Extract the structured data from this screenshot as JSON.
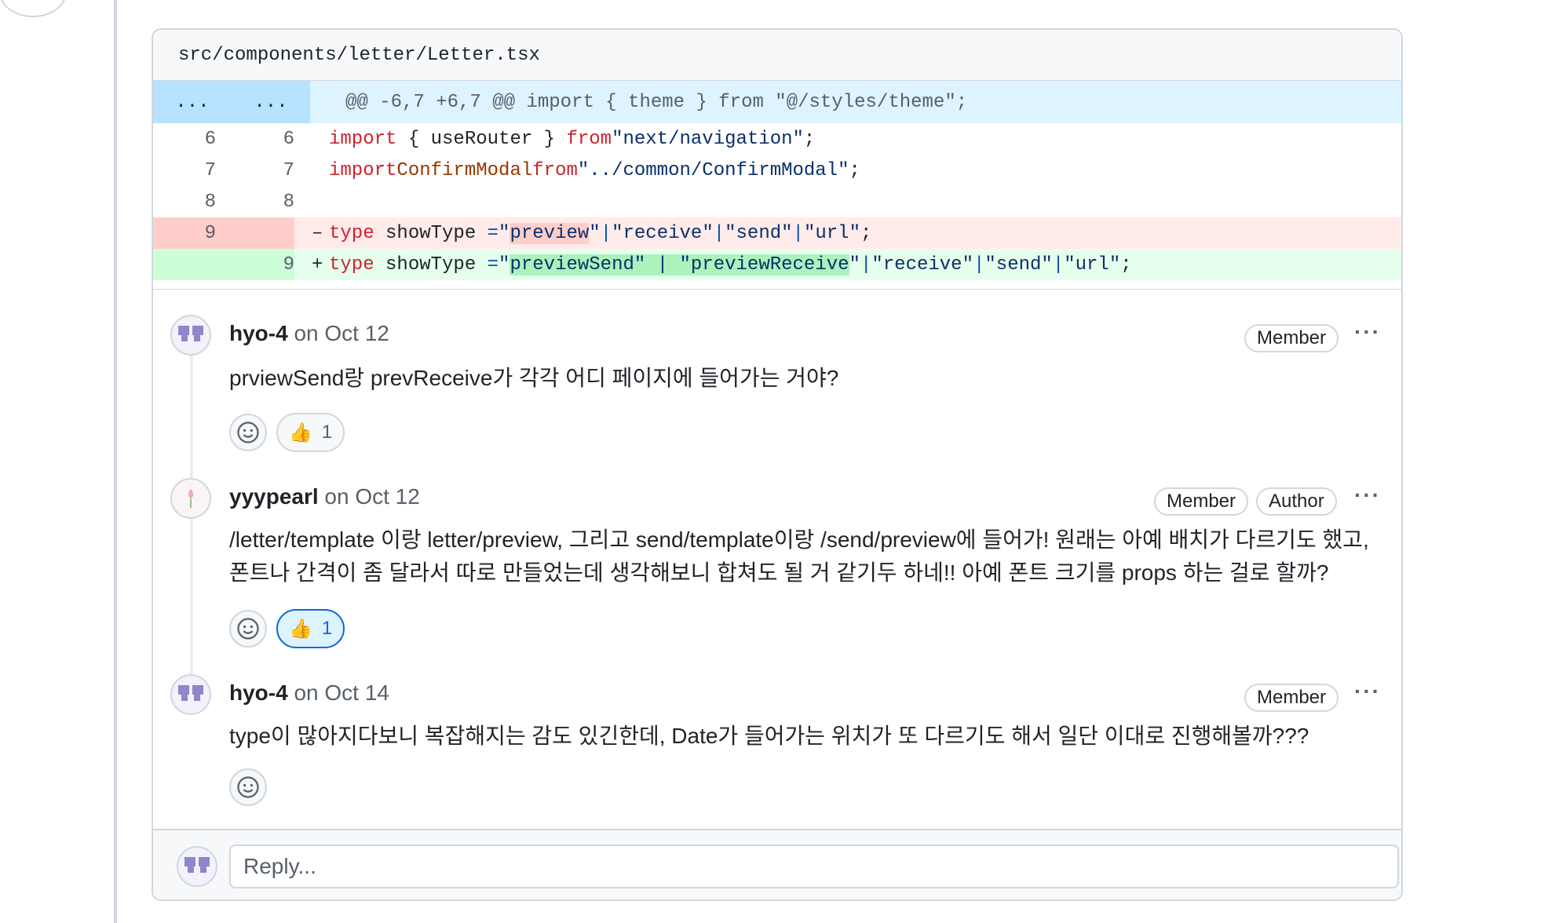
{
  "file": {
    "path": "src/components/letter/Letter.tsx"
  },
  "diff": {
    "hunk": {
      "old_marker": "...",
      "new_marker": "...",
      "header": "@@ -6,7 +6,7 @@ import { theme } from \"@/styles/theme\";"
    },
    "lines": [
      {
        "old": "6",
        "new": "6",
        "type": "context"
      },
      {
        "old": "7",
        "new": "7",
        "type": "context"
      },
      {
        "old": "8",
        "new": "8",
        "type": "context"
      },
      {
        "old": "9",
        "new": "",
        "type": "deletion"
      },
      {
        "old": "",
        "new": "9",
        "type": "addition"
      }
    ],
    "tokens": {
      "import": "import",
      "from": "from",
      "type": "type",
      "use_router_braces": " { useRouter } ",
      "next_nav": "\"next/navigation\"",
      "confirm_modal": "ConfirmModal",
      "confirm_modal_path": "\"../common/ConfirmModal\"",
      "semicolon": ";",
      "show_type": " showType ",
      "eq": "=",
      "pipe": "|",
      "del_marker": "–",
      "add_marker": "+",
      "preview": "preview",
      "preview_send": "previewSend",
      "preview_receive": "previewReceive",
      "receive": "\"receive\"",
      "send": "\"send\"",
      "url": "\"url\""
    }
  },
  "comments": [
    {
      "author": "hyo-4",
      "date": "on Oct 12",
      "badges": [
        "Member"
      ],
      "body": "prviewSend랑 prevReceive가 각각 어디 페이지에 들어가는 거야?",
      "reaction": {
        "emoji": "👍",
        "count": "1",
        "active": false
      }
    },
    {
      "author": "yyypearl",
      "date": "on Oct 12",
      "badges": [
        "Member",
        "Author"
      ],
      "body_line1": "/letter/template 이랑 letter/preview, 그리고 send/template이랑 /send/preview에 들어가! 원래는 아예 배치가 다르기도 했고,",
      "body_line2": "폰트나 간격이 좀 달라서 따로 만들었는데 생각해보니 합쳐도 될 거 같기두 하네!! 아예 폰트 크기를 props 하는 걸로 할까?",
      "reaction": {
        "emoji": "👍",
        "count": "1",
        "active": true
      }
    },
    {
      "author": "hyo-4",
      "date": "on Oct 14",
      "badges": [
        "Member"
      ],
      "body": "type이 많아지다보니 복잡해지는 감도 있긴한데, Date가 들어가는 위치가 또 다르기도 해서 일단 이대로 진행해볼까???"
    }
  ],
  "kebab_label": "···",
  "reply": {
    "placeholder": "Reply..."
  },
  "icons": {
    "avatar_identicon": "identicon-avatar",
    "avatar_flower": "flower-avatar",
    "smiley": "smiley-icon"
  },
  "colors": {
    "hunk_bg": "#ddf4ff",
    "deletion_bg": "#ffebe9",
    "addition_bg": "#e6ffec",
    "active_reaction": "#0969da"
  }
}
